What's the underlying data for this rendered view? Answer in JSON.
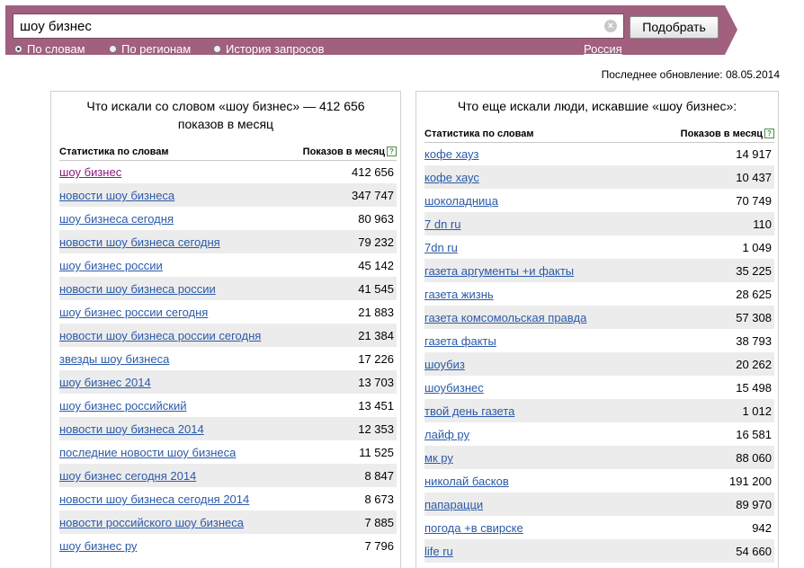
{
  "search": {
    "query": "шоу бизнес",
    "submit_label": "Подобрать",
    "clear_symbol": "×",
    "modes": [
      {
        "label": "По словам",
        "selected": true
      },
      {
        "label": "По регионам",
        "selected": false
      },
      {
        "label": "История запросов",
        "selected": false
      }
    ],
    "region": "Россия"
  },
  "last_updated": "Последнее обновление: 08.05.2014",
  "left_panel": {
    "title_line1": "Что искали со словом «шоу бизнес» — 412 656",
    "title_line2": "показов в месяц",
    "col_phrase": "Статистика по словам",
    "col_count": "Показов в месяц",
    "rows": [
      {
        "phrase": "шоу бизнес",
        "count": "412 656"
      },
      {
        "phrase": "новости шоу бизнеса",
        "count": "347 747"
      },
      {
        "phrase": "шоу бизнеса сегодня",
        "count": "80 963"
      },
      {
        "phrase": "новости шоу бизнеса сегодня",
        "count": "79 232"
      },
      {
        "phrase": "шоу бизнес россии",
        "count": "45 142"
      },
      {
        "phrase": "новости шоу бизнеса россии",
        "count": "41 545"
      },
      {
        "phrase": "шоу бизнес россии сегодня",
        "count": "21 883"
      },
      {
        "phrase": "новости шоу бизнеса россии сегодня",
        "count": "21 384"
      },
      {
        "phrase": "звезды шоу бизнеса",
        "count": "17 226"
      },
      {
        "phrase": "шоу бизнес 2014",
        "count": "13 703"
      },
      {
        "phrase": "шоу бизнес российский",
        "count": "13 451"
      },
      {
        "phrase": "новости шоу бизнеса 2014",
        "count": "12 353"
      },
      {
        "phrase": "последние новости шоу бизнеса",
        "count": "11 525"
      },
      {
        "phrase": "шоу бизнес сегодня 2014",
        "count": "8 847"
      },
      {
        "phrase": "новости шоу бизнеса сегодня 2014",
        "count": "8 673"
      },
      {
        "phrase": "новости российского шоу бизнеса",
        "count": "7 885"
      },
      {
        "phrase": "шоу бизнес ру",
        "count": "7 796"
      }
    ]
  },
  "right_panel": {
    "title": "Что еще искали люди, искавшие «шоу бизнес»:",
    "col_phrase": "Статистика по словам",
    "col_count": "Показов в месяц",
    "rows": [
      {
        "phrase": "кофе хауз",
        "count": "14 917"
      },
      {
        "phrase": "кофе хаус",
        "count": "10 437"
      },
      {
        "phrase": "шоколадница",
        "count": "70 749"
      },
      {
        "phrase": "7 dn ru",
        "count": "110"
      },
      {
        "phrase": "7dn ru",
        "count": "1 049"
      },
      {
        "phrase": "газета аргументы +и факты",
        "count": "35 225"
      },
      {
        "phrase": "газета жизнь",
        "count": "28 625"
      },
      {
        "phrase": "газета комсомольская правда",
        "count": "57 308"
      },
      {
        "phrase": "газета факты",
        "count": "38 793"
      },
      {
        "phrase": "шоубиз",
        "count": "20 262"
      },
      {
        "phrase": "шоубизнес",
        "count": "15 498"
      },
      {
        "phrase": "твой день газета",
        "count": "1 012"
      },
      {
        "phrase": "лайф ру",
        "count": "16 581"
      },
      {
        "phrase": "мк ру",
        "count": "88 060"
      },
      {
        "phrase": "николай басков",
        "count": "191 200"
      },
      {
        "phrase": "папарацци",
        "count": "89 970"
      },
      {
        "phrase": "погода +в свирске",
        "count": "942"
      },
      {
        "phrase": "life ru",
        "count": "54 660"
      }
    ]
  },
  "colors": {
    "band": "#a0607e",
    "link": "#2b5aa8",
    "visited_link": "#8b1a7e",
    "stripe": "#ececec"
  }
}
